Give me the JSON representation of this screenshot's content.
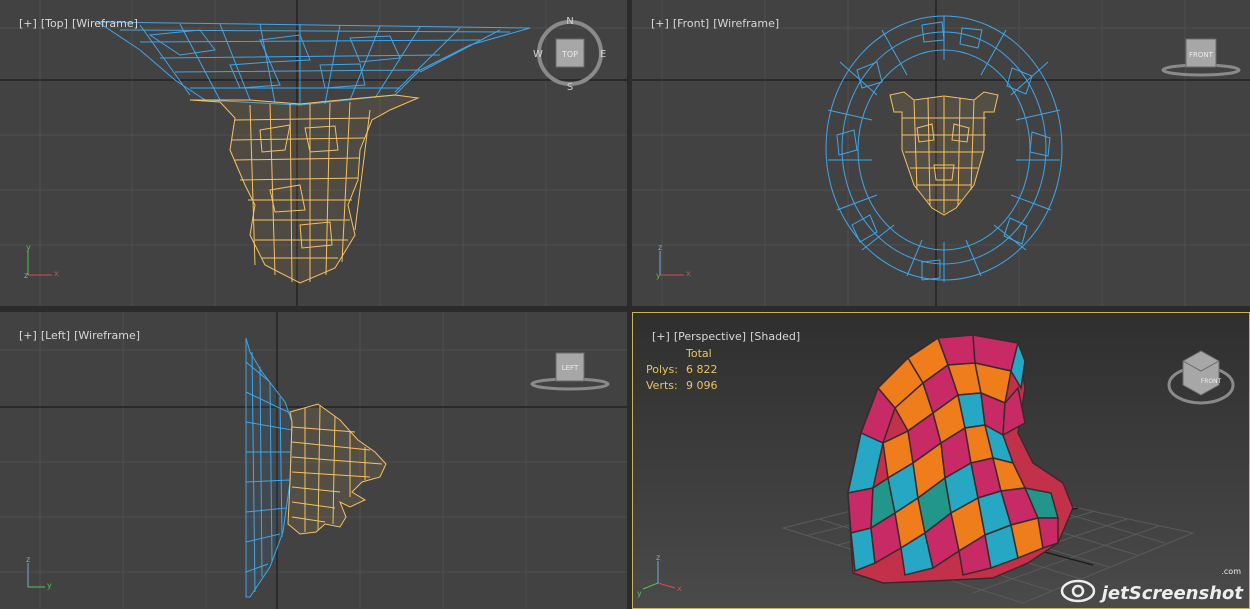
{
  "viewports": {
    "top": {
      "plus": "[+]",
      "view": "[Top]",
      "mode": "[Wireframe]",
      "cube_label": "TOP",
      "compass": {
        "n": "N",
        "s": "S",
        "e": "E",
        "w": "W"
      }
    },
    "front": {
      "plus": "[+]",
      "view": "[Front]",
      "mode": "[Wireframe]",
      "cube_label": "FRONT"
    },
    "left": {
      "plus": "[+]",
      "view": "[Left]",
      "mode": "[Wireframe]",
      "cube_label": "LEFT"
    },
    "perspective": {
      "plus": "[+]",
      "view": "[Perspective]",
      "mode": "[Shaded]",
      "cube_label": "FRONT"
    }
  },
  "stats": {
    "header": "Total",
    "polys_label": "Polys:",
    "polys_value": "6 822",
    "verts_label": "Verts:",
    "verts_value": "9 096"
  },
  "axes": {
    "x": "x",
    "y": "y",
    "z": "z"
  },
  "watermark": {
    "brand": "jetScreenshot",
    "suffix": ".com"
  },
  "colors": {
    "viewport_bg": "#424242",
    "wire_blue": "#3fa6e8",
    "wire_yellow": "#f7c15f",
    "active_border": "#c8b45a",
    "grid": "#4e4e4e",
    "grid_axis": "#1c1c1c"
  }
}
